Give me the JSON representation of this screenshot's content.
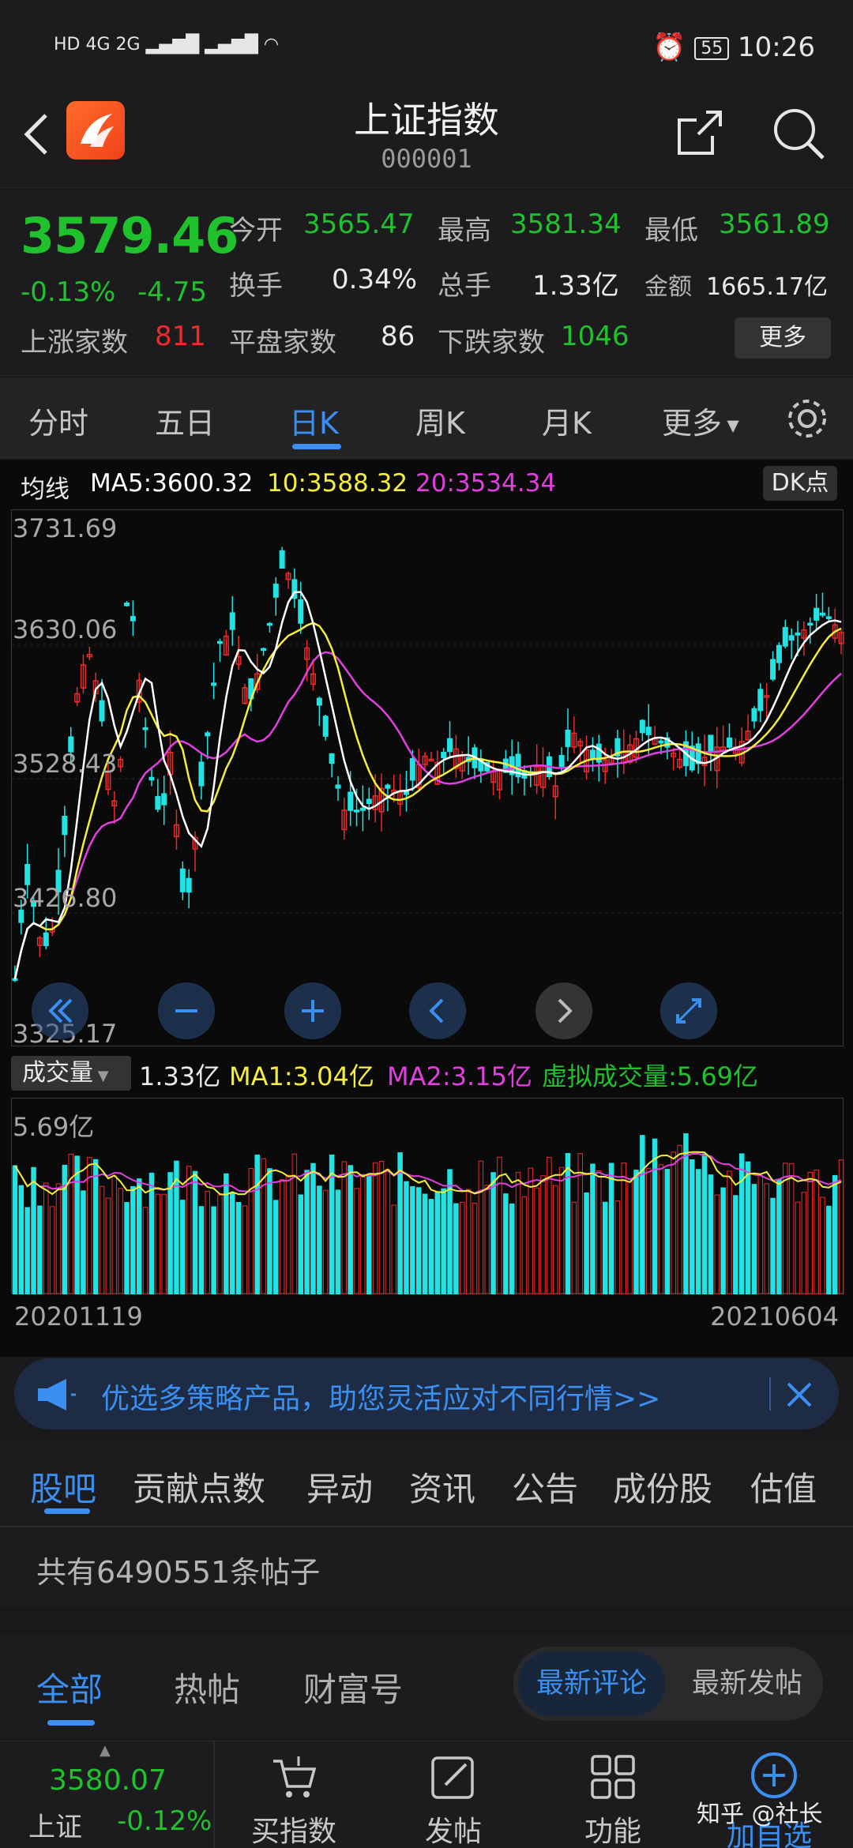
{
  "status_bar": {
    "left": "HD 4G 2G",
    "battery": "55",
    "time": "10:26"
  },
  "header": {
    "title": "上证指数",
    "code": "000001"
  },
  "quote": {
    "price": "3579.46",
    "change_pct": "-0.13%",
    "change": "-4.75",
    "open_label": "今开",
    "open": "3565.47",
    "high_label": "最高",
    "high": "3581.34",
    "low_label": "最低",
    "low": "3561.89",
    "turnover_label": "换手",
    "turnover": "0.34%",
    "volume_label": "总手",
    "volume": "1.33亿",
    "amount_label": "金额",
    "amount": "1665.17亿",
    "up_label": "上涨家数",
    "up": "811",
    "flat_label": "平盘家数",
    "flat": "86",
    "down_label": "下跌家数",
    "down": "1046",
    "more": "更多"
  },
  "tabs": [
    "分时",
    "五日",
    "日K",
    "周K",
    "月K",
    "更多"
  ],
  "ma": {
    "label": "均线",
    "ma5": "MA5:3600.32",
    "ma10": "10:3588.32",
    "ma20": "20:3534.34",
    "dk": "DK点"
  },
  "kline": {
    "y_labels": [
      "3731.69",
      "3630.06",
      "3528.43",
      "3426.80",
      "3325.17"
    ]
  },
  "volume": {
    "selector": "成交量",
    "vol": "1.33亿",
    "ma1": "MA1:3.04亿",
    "ma2": "MA2:3.15亿",
    "virtual": "虚拟成交量:5.69亿",
    "max": "5.69亿"
  },
  "dates": {
    "start": "20201119",
    "end": "20210604"
  },
  "banner": {
    "text": "优选多策略产品，助您灵活应对不同行情>>"
  },
  "section_tabs": [
    "股吧",
    "贡献点数",
    "异动",
    "资讯",
    "公告",
    "成份股",
    "估值"
  ],
  "posts": "共有6490551条帖子",
  "sub_tabs": [
    "全部",
    "热帖",
    "财富号"
  ],
  "sort": {
    "latest_comment": "最新评论",
    "latest_post": "最新发帖"
  },
  "bottom": {
    "index_price": "3580.07",
    "index_name": "上证",
    "index_change": "-0.12%",
    "buy": "买指数",
    "post": "发帖",
    "func": "功能",
    "add": "加自选",
    "watermark": "知乎 @社长"
  },
  "colors": {
    "up": "#ee2a2a",
    "down": "#1fc12d",
    "accent": "#3a8ff0",
    "candle_down": "#22e3e3",
    "ma5": "#ffffff",
    "ma10": "#f5ee3a",
    "ma20": "#e23fe0"
  }
}
